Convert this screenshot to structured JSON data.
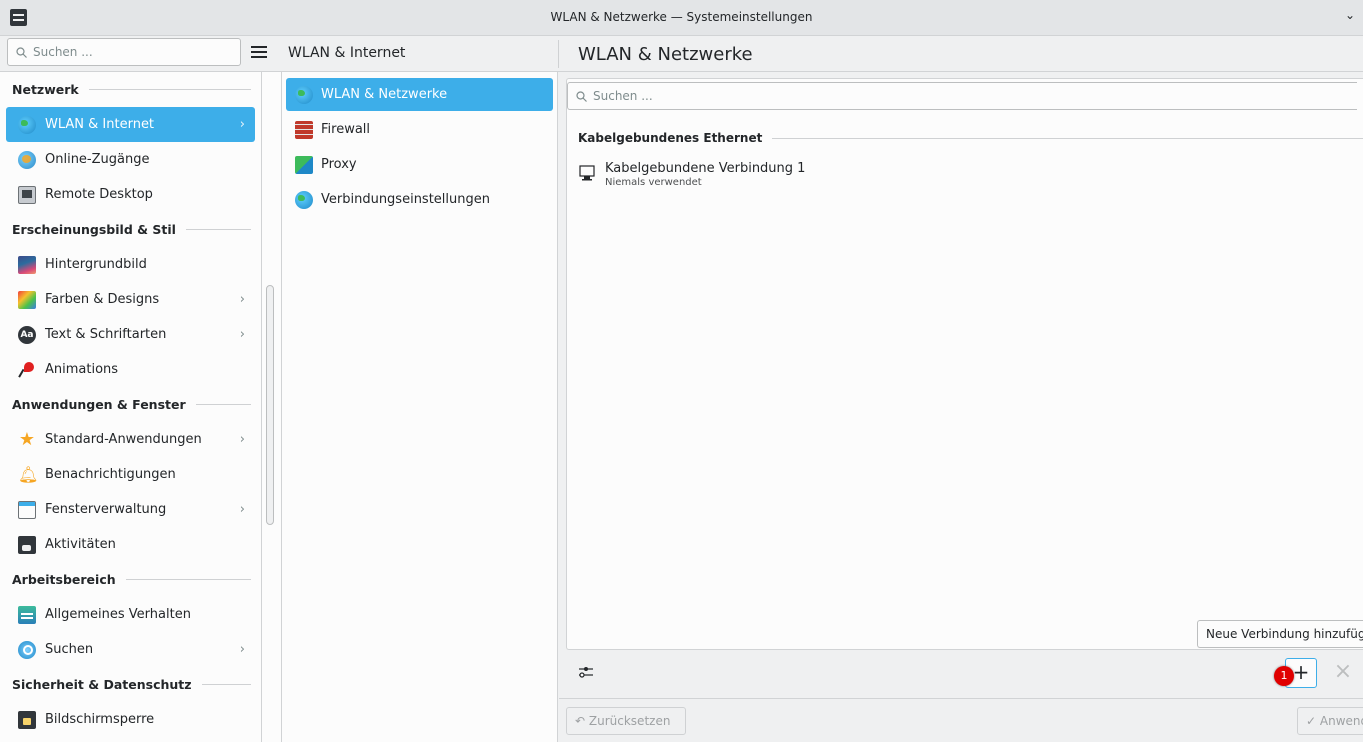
{
  "window": {
    "title": "WLAN & Netzwerke — Systemeinstellungen",
    "chevron": "⌄"
  },
  "search_sidebar": {
    "placeholder": "Suchen ...",
    "icon": "magnifier"
  },
  "middle_header": {
    "title": "WLAN & Internet"
  },
  "right_header": {
    "title": "WLAN & Netzwerke"
  },
  "sidebar": {
    "sections": [
      {
        "title": "Netzwerk",
        "items": [
          {
            "label": "WLAN & Internet",
            "icon": "globe-icon",
            "selected": true,
            "arrow": "›"
          },
          {
            "label": "Online-Zugänge",
            "icon": "online-icon",
            "arrow": ""
          },
          {
            "label": "Remote Desktop",
            "icon": "remote-icon",
            "arrow": ""
          }
        ]
      },
      {
        "title": "Erscheinungsbild & Stil",
        "items": [
          {
            "label": "Hintergrundbild",
            "icon": "wallpaper-icon",
            "arrow": ""
          },
          {
            "label": "Farben & Designs",
            "icon": "colors-icon",
            "arrow": "›"
          },
          {
            "label": "Text & Schriftarten",
            "icon": "fonts-icon",
            "arrow": "›"
          },
          {
            "label": "Animations",
            "icon": "animation-icon",
            "arrow": ""
          }
        ]
      },
      {
        "title": "Anwendungen & Fenster",
        "items": [
          {
            "label": "Standard-Anwendungen",
            "icon": "star-icon",
            "arrow": "›"
          },
          {
            "label": "Benachrichtigungen",
            "icon": "bell-icon",
            "arrow": ""
          },
          {
            "label": "Fensterverwaltung",
            "icon": "window-icon",
            "arrow": "›"
          },
          {
            "label": "Aktivitäten",
            "icon": "activity-icon",
            "arrow": ""
          }
        ]
      },
      {
        "title": "Arbeitsbereich",
        "items": [
          {
            "label": "Allgemeines Verhalten",
            "icon": "general-icon",
            "arrow": ""
          },
          {
            "label": "Suchen",
            "icon": "search-icon",
            "arrow": "›"
          }
        ]
      },
      {
        "title": "Sicherheit & Datenschutz",
        "items": [
          {
            "label": "Bildschirmsperre",
            "icon": "lock-icon",
            "arrow": ""
          }
        ]
      }
    ]
  },
  "middle": {
    "items": [
      {
        "label": "WLAN & Netzwerke",
        "icon": "globe-icon",
        "selected": true
      },
      {
        "label": "Firewall",
        "icon": "firewall-icon"
      },
      {
        "label": "Proxy",
        "icon": "proxy-icon"
      },
      {
        "label": "Verbindungseinstellungen",
        "icon": "globe-icon"
      }
    ]
  },
  "right": {
    "search_placeholder": "Suchen ...",
    "group_title": "Kabelgebundenes Ethernet",
    "connection": {
      "name": "Kabelgebundene Verbindung 1",
      "status": "Niemals verwendet"
    },
    "tooltip": "Neue Verbindung hinzufügen",
    "plus": "+",
    "badge": "1",
    "close": "×",
    "reset_label": "Zurücksetzen",
    "apply_label": "Anwenden"
  },
  "colors": {
    "accent": "#3daee9",
    "badge": "#e00000"
  }
}
